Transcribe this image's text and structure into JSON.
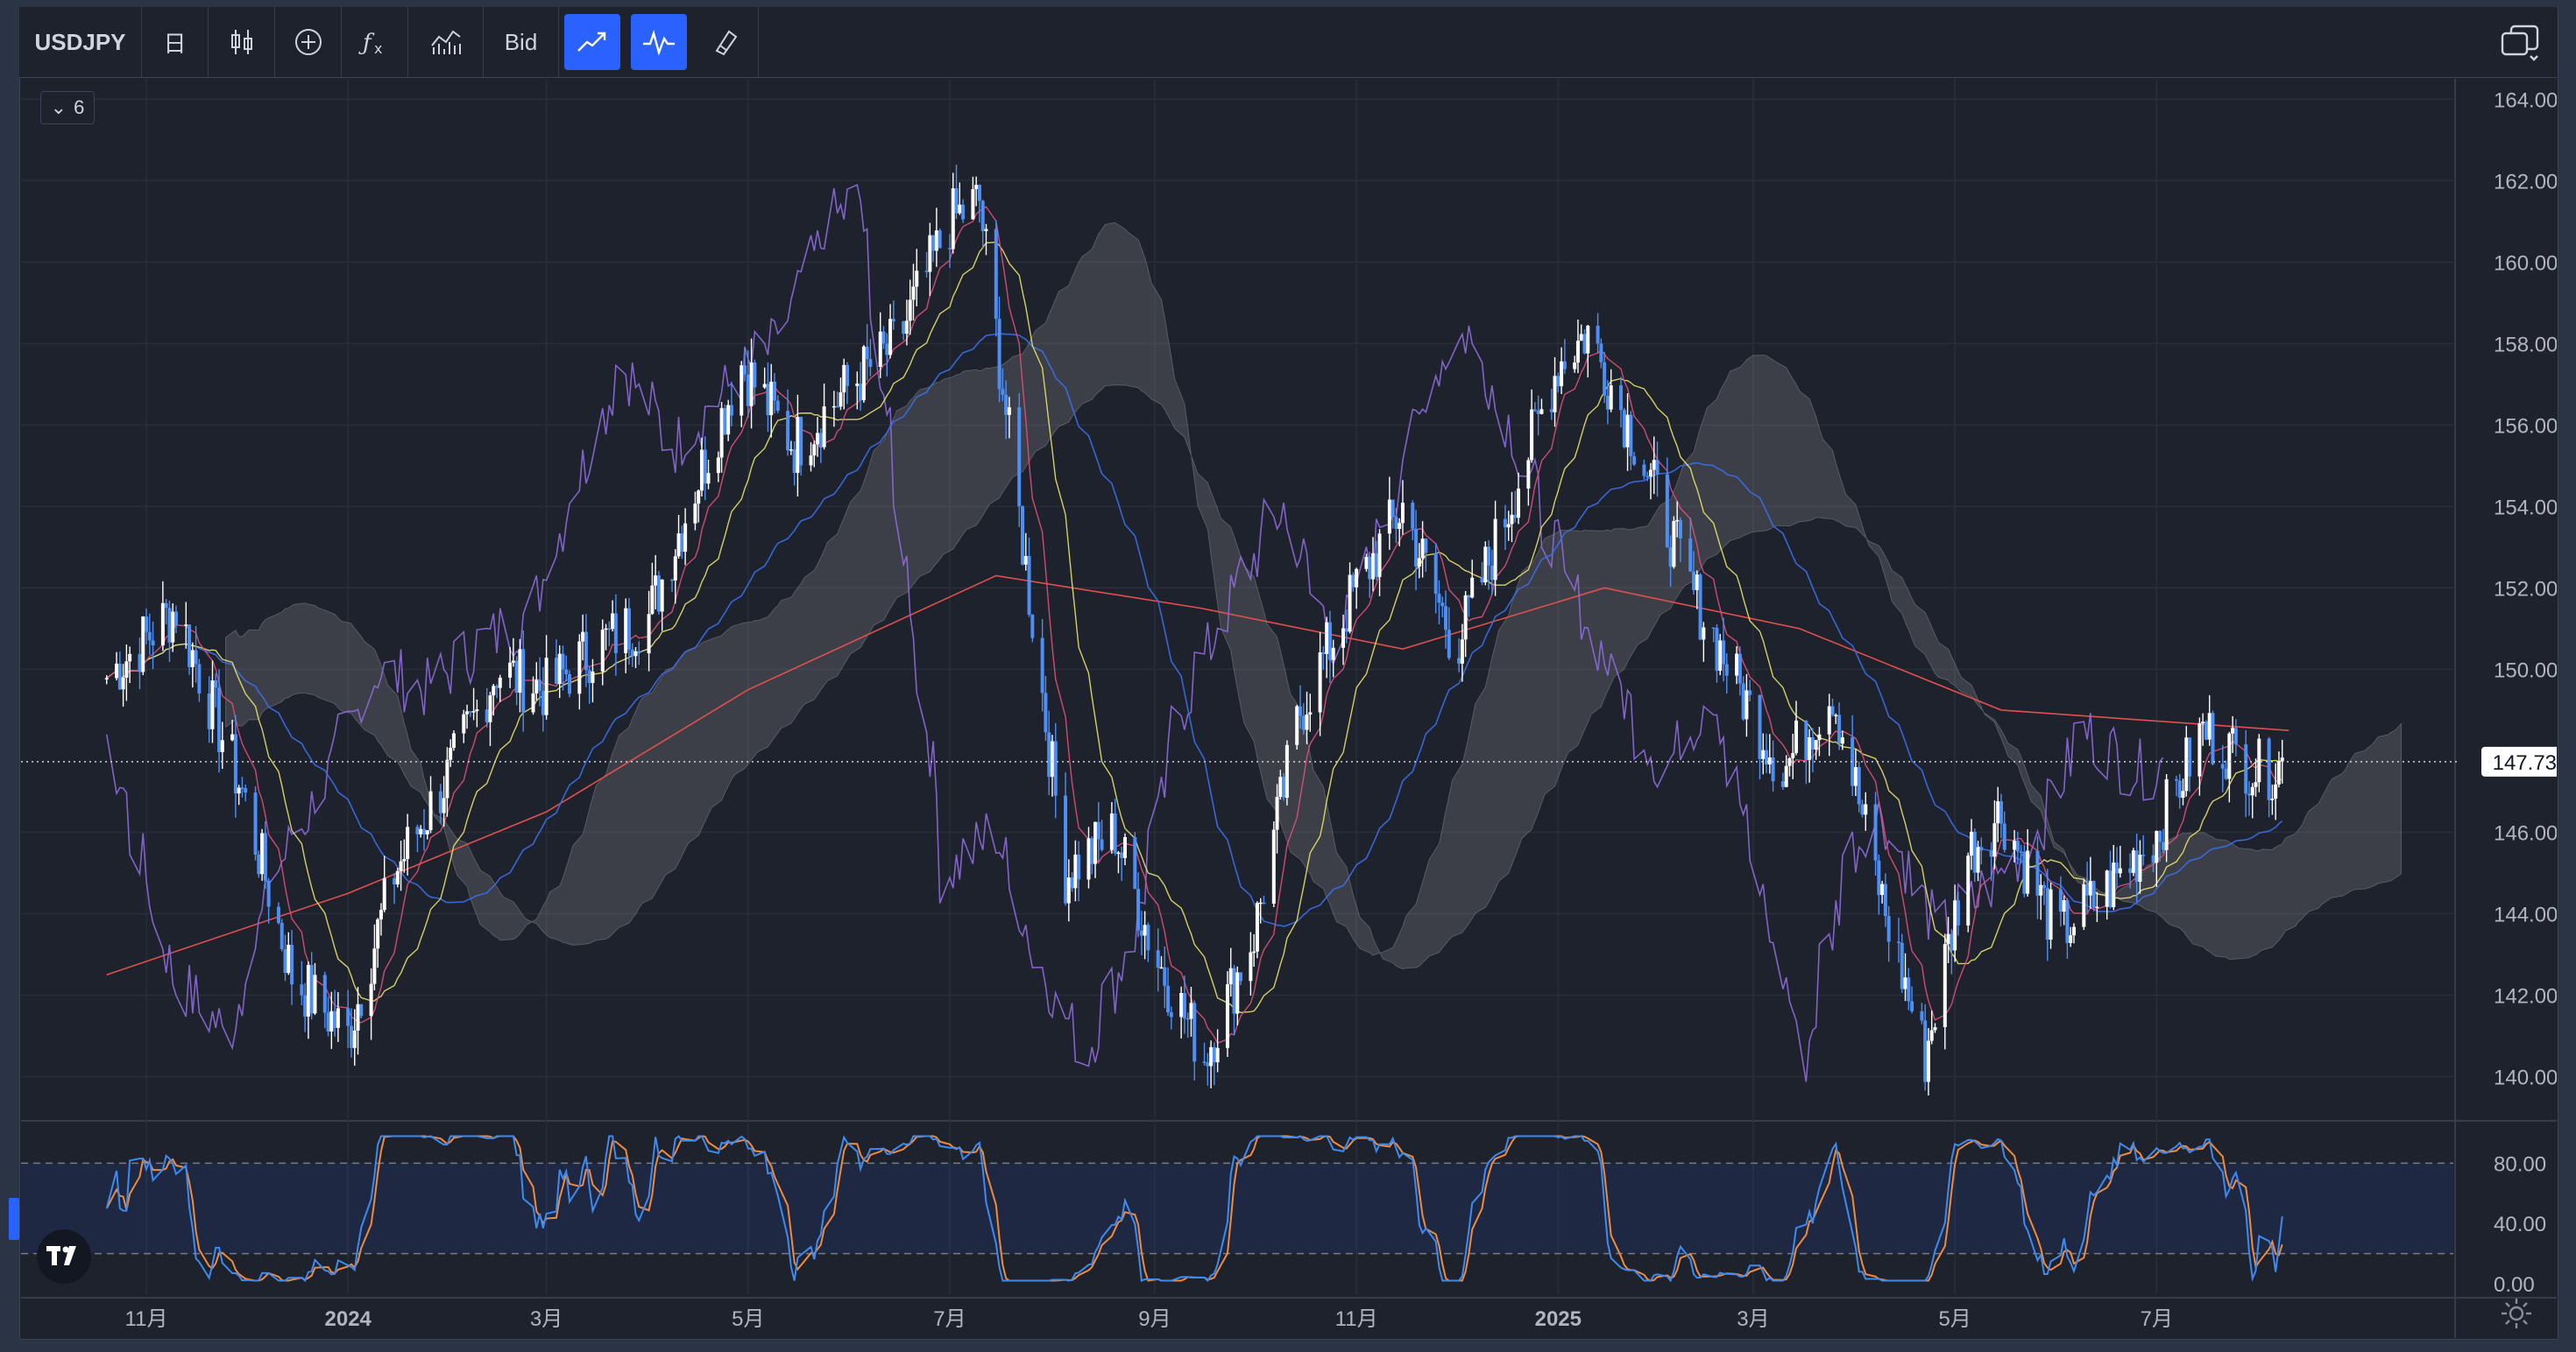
{
  "toolbar": {
    "symbol": "USDJPY",
    "interval": "日",
    "price_type": "Bid",
    "icons": [
      "candles-icon",
      "add-indicator-icon",
      "fx-icon",
      "compare-icon",
      "line-tool-icon",
      "wave-tool-icon",
      "brush-icon"
    ]
  },
  "pane_toggle": {
    "count": "6"
  },
  "chart_data": {
    "type": "line",
    "symbol": "USDJPY",
    "price_axis": {
      "ticks": [
        "164.000",
        "162.000",
        "160.000",
        "158.000",
        "156.000",
        "154.000",
        "152.000",
        "150.000",
        "146.000",
        "144.000",
        "142.000",
        "140.000"
      ],
      "ylim": [
        139.0,
        164.5
      ]
    },
    "current_price": "147.732",
    "time_axis": [
      "11月",
      "2024",
      "3月",
      "5月",
      "7月",
      "9月",
      "11月",
      "2025",
      "3月",
      "5月",
      "7月"
    ],
    "oscillator": {
      "ticks": [
        "80.00",
        "40.00",
        "0.00"
      ],
      "upper_band": 80,
      "lower_band": 20,
      "ylim": [
        0,
        100
      ]
    },
    "series": [
      {
        "kind": "close",
        "x": [
          "2023-10-20",
          "2023-11-10",
          "2023-11-30",
          "2023-12-15",
          "2024-01-01",
          "2024-01-15",
          "2024-02-01",
          "2024-02-15",
          "2024-03-01",
          "2024-03-15",
          "2024-04-01",
          "2024-04-15",
          "2024-04-29",
          "2024-05-15",
          "2024-06-01",
          "2024-06-15",
          "2024-07-01",
          "2024-07-10",
          "2024-07-20",
          "2024-08-05",
          "2024-08-20",
          "2024-09-01",
          "2024-09-16",
          "2024-10-01",
          "2024-10-15",
          "2024-11-01",
          "2024-11-15",
          "2024-12-01",
          "2024-12-15",
          "2025-01-01",
          "2025-01-10",
          "2025-01-25",
          "2025-02-10",
          "2025-02-25",
          "2025-03-10",
          "2025-03-25",
          "2025-04-10",
          "2025-04-22",
          "2025-05-05",
          "2025-05-15",
          "2025-06-01",
          "2025-06-15",
          "2025-07-01",
          "2025-07-15",
          "2025-08-01",
          "2025-08-10"
        ],
        "values": [
          149.8,
          151.5,
          147.0,
          142.5,
          141.0,
          145.0,
          147.5,
          150.0,
          149.5,
          150.5,
          151.3,
          154.5,
          157.5,
          155.5,
          157.0,
          158.0,
          161.0,
          161.5,
          155.0,
          145.0,
          146.0,
          143.0,
          140.5,
          143.5,
          149.0,
          152.0,
          154.0,
          150.5,
          153.5,
          157.5,
          158.3,
          155.5,
          152.0,
          149.5,
          147.5,
          149.5,
          144.0,
          140.5,
          145.5,
          146.5,
          143.5,
          144.5,
          146.0,
          148.5,
          147.5,
          147.7
        ]
      },
      {
        "kind": "ma200",
        "x": [
          "2023-10-20",
          "2024-01-01",
          "2024-03-01",
          "2024-05-01",
          "2024-07-15",
          "2024-09-15",
          "2024-11-15",
          "2025-01-15",
          "2025-03-15",
          "2025-05-15",
          "2025-08-10"
        ],
        "values": [
          142.5,
          144.5,
          146.5,
          149.5,
          152.3,
          151.5,
          150.5,
          152.0,
          151.0,
          149.0,
          148.5
        ]
      }
    ],
    "colors": {
      "up_candle": "#ffffff",
      "down_candle": "#4d8ff5",
      "ma_fast": "#e0507a",
      "ma_mid": "#e8e26a",
      "ma_long": "#3a6ee8",
      "ma_200": "#e0504d",
      "lagging_span": "#8d6ad8",
      "cloud": "#a7a7a7",
      "stoch_k": "#3d8af0",
      "stoch_d": "#f08a3d"
    }
  }
}
